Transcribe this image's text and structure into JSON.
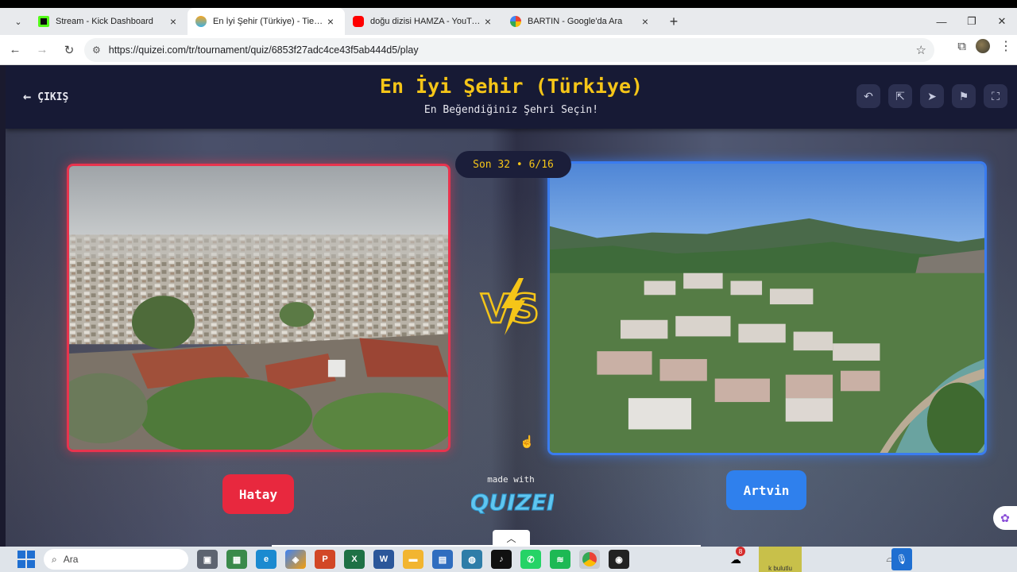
{
  "browser": {
    "tabs": [
      {
        "title": "Stream - Kick Dashboard",
        "favicon_color": "#53fc18",
        "active": false
      },
      {
        "title": "En İyi Şehir (Türkiye) - Tier List,",
        "favicon_color": "#f5a623",
        "active": true
      },
      {
        "title": "doğu dizisi HAMZA - YouTube",
        "favicon_color": "#ff0000",
        "active": false
      },
      {
        "title": "BARTIN - Google'da Ara",
        "favicon_color": "#4285f4",
        "active": false
      }
    ],
    "url": "https://quizei.com/tr/tournament/quiz/6853f27adc4ce43f5ab444d5/play"
  },
  "page": {
    "exit_label": "ÇIKIŞ",
    "title": "En İyi Şehir (Türkiye)",
    "subtitle": "En Beğendiğiniz Şehri Seçin!",
    "progress": "Son 32 • 6/16",
    "left_choice": "Hatay",
    "right_choice": "Artvin",
    "made_with": "made with",
    "brand": "QUIZEI",
    "vs": "VS"
  },
  "taskbar": {
    "search_placeholder": "Ara",
    "weather_badge": "8",
    "thumb_label": "k bulutlu"
  },
  "colors": {
    "title_gold": "#f5c518",
    "left_accent": "#e8283e",
    "right_accent": "#2f80ed",
    "header_bg": "#171a35"
  }
}
